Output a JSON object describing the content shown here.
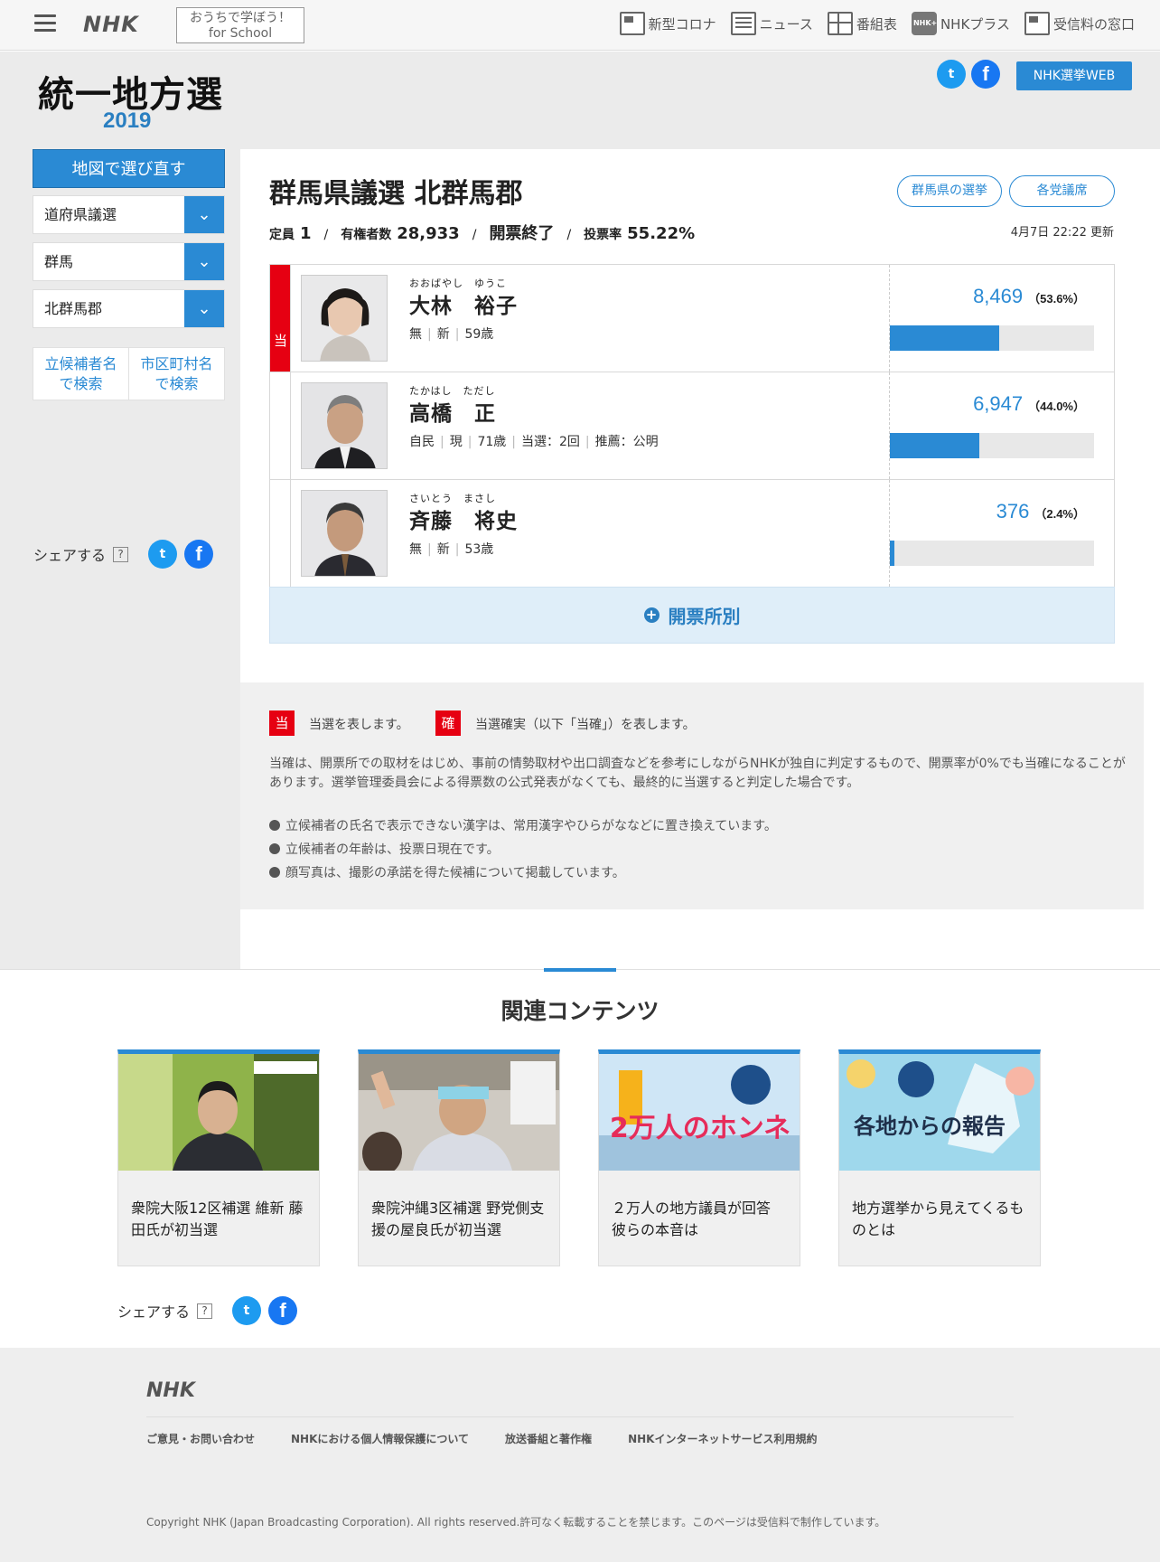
{
  "topbar": {
    "logo": "NHK",
    "school_line1": "おうちで学ぼう！",
    "school_line2": "for School",
    "nav": [
      {
        "label": "新型コロナ",
        "icon": "tv-news-icon"
      },
      {
        "label": "ニュース",
        "icon": "newspaper-icon"
      },
      {
        "label": "番組表",
        "icon": "program-grid-icon"
      },
      {
        "label": "NHKプラス",
        "icon": "nhk-plus-icon"
      },
      {
        "label": "受信料の窓口",
        "icon": "receiver-icon"
      }
    ],
    "plus_icon_text": "NHK+"
  },
  "brand": {
    "title": "統一地方選",
    "year": "2019",
    "election_web": "NHK選挙WEB",
    "twitter_glyph": "t",
    "facebook_glyph": "f"
  },
  "sidebar": {
    "map_button": "地図で選び直す",
    "select_type": "道府県議選",
    "select_prefecture": "群馬",
    "select_district": "北群馬郡",
    "search_candidate": "立候補者名\nで検索",
    "search_city": "市区町村名\nで検索",
    "share_label": "シェアする",
    "help": "?"
  },
  "result": {
    "title": "群馬県議選 北群馬郡",
    "pill_prefecture": "群馬県の選挙",
    "pill_party": "各党議席",
    "seats_label": "定員",
    "seats": "1",
    "voters_label": "有権者数",
    "voters": "28,933",
    "status": "開票終了",
    "turnout_label": "投票率",
    "turnout": "55.22%",
    "separator": "/",
    "updated": "4月7日 22:22 更新",
    "elected_mark": "当",
    "candidates": [
      {
        "kana": "おおばやし　ゆうこ",
        "name": "大林　裕子",
        "info": [
          "無",
          "新",
          "59歳"
        ],
        "votes": "8,469",
        "pct": "（53.6%）",
        "share": 0.536,
        "elected": true
      },
      {
        "kana": "たかはし　ただし",
        "name": "高橋　正",
        "info": [
          "自民",
          "現",
          "71歳",
          "当選：2回",
          "推薦：公明"
        ],
        "votes": "6,947",
        "pct": "（44.0%）",
        "share": 0.44,
        "elected": false
      },
      {
        "kana": "さいとう　まさし",
        "name": "斉藤　将史",
        "info": [
          "無",
          "新",
          "53歳"
        ],
        "votes": "376",
        "pct": "（2.4%）",
        "share": 0.024,
        "elected": false
      }
    ],
    "precinct_button": "開票所別",
    "precinct_plus": "+"
  },
  "legend": {
    "win_badge": "当",
    "win_text": "当選を表します。",
    "sure_badge": "確",
    "sure_text": "当選確実（以下「当確」）を表します。",
    "note": "当確は、開票所での取材をはじめ、事前の情勢取材や出口調査などを参考にしながらNHKが独自に判定するもので、開票率が0%でも当確になることがあります。選挙管理委員会による得票数の公式発表がなくても、最終的に当選すると判定した場合です。",
    "bullets": [
      "立候補者の氏名で表示できない漢字は、常用漢字やひらがななどに置き換えています。",
      "立候補者の年齢は、投票日現在です。",
      "顔写真は、撮影の承諾を得た候補について掲載しています。"
    ]
  },
  "related": {
    "title": "関連コンテンツ",
    "cards": [
      {
        "text": "衆院大阪12区補選 維新 藤田氏が初当選"
      },
      {
        "text": "衆院沖縄3区補選 野党側支援の屋良氏が初当選"
      },
      {
        "text": "２万人の地方議員が回答 彼らの本音は"
      },
      {
        "text": "地方選挙から見えてくるものとは"
      }
    ],
    "thumb_text_3": "2万人のホンネ",
    "thumb_text_4": "各地からの報告",
    "share_label": "シェアする",
    "help": "?"
  },
  "footer": {
    "logo": "NHK",
    "links": [
      "ご意見・お問い合わせ",
      "NHKにおける個人情報保護について",
      "放送番組と著作権",
      "NHKインターネットサービス利用規約"
    ],
    "copyright": "Copyright NHK (Japan Broadcasting Corporation). All rights reserved.許可なく転載することを禁じます。このページは受信料で制作しています。"
  }
}
